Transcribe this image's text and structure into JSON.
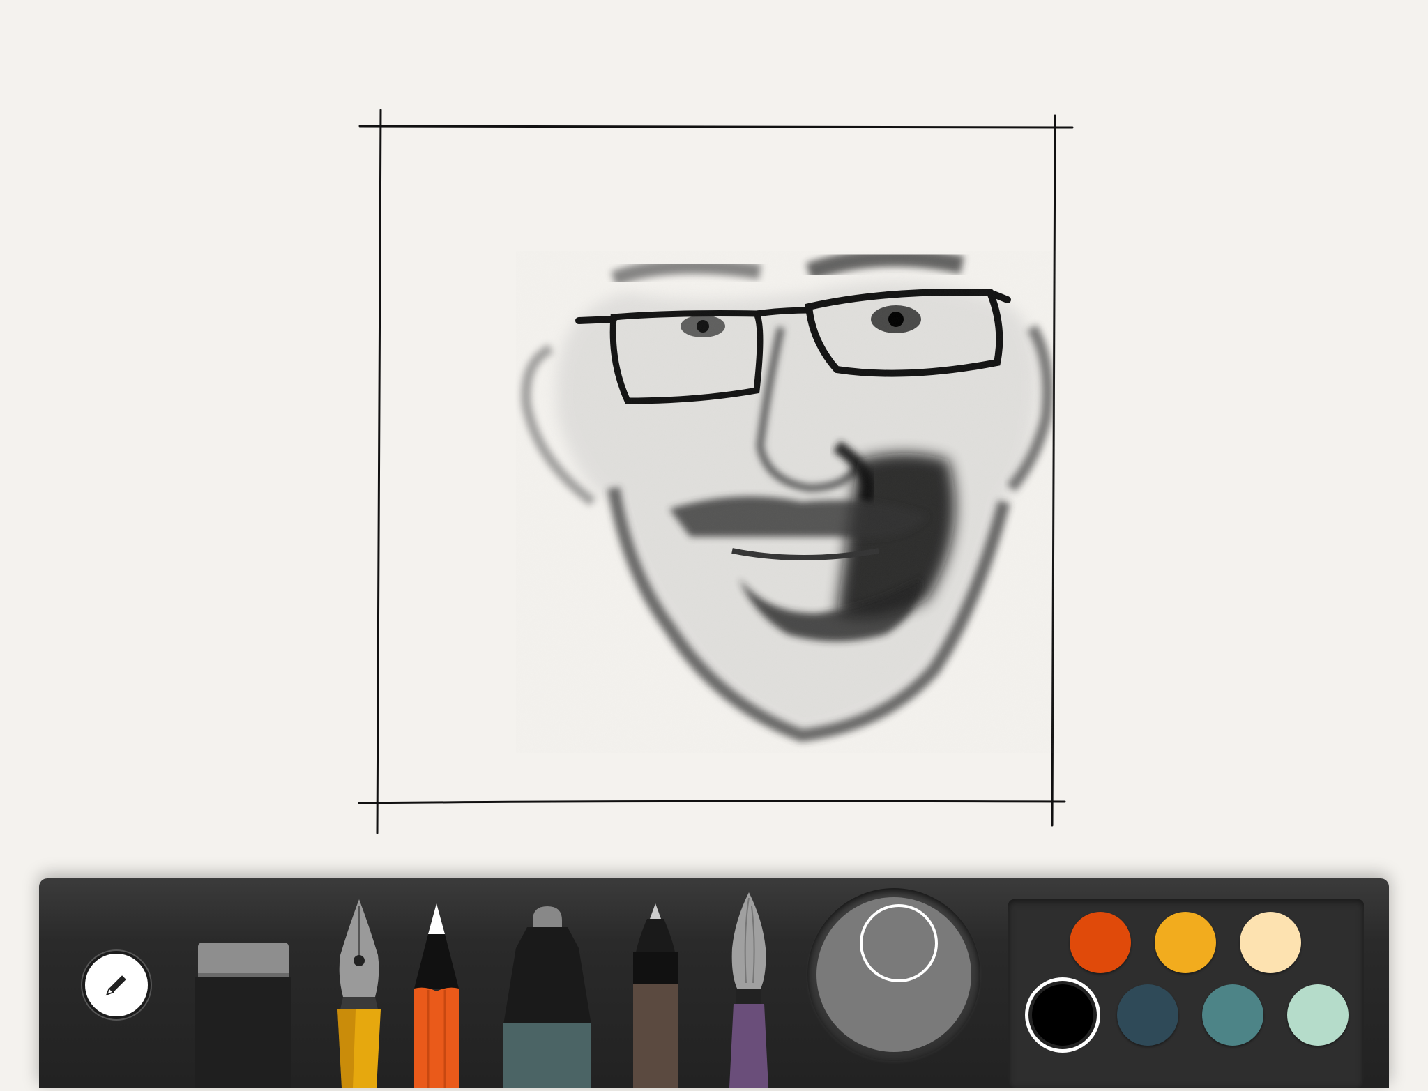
{
  "app": {
    "accent": "#e8e6e1"
  },
  "toolbar": {
    "menu_icon": "pencil-icon",
    "tools": [
      {
        "id": "eraser",
        "icon": "eraser-icon"
      },
      {
        "id": "fountain-pen",
        "icon": "fountain-pen-icon"
      },
      {
        "id": "pencil",
        "icon": "pencil-tool-icon"
      },
      {
        "id": "marker",
        "icon": "marker-icon"
      },
      {
        "id": "fineliner",
        "icon": "fineliner-icon"
      },
      {
        "id": "watercolor-brush",
        "icon": "brush-icon"
      }
    ],
    "current_color": "#7a7a7a"
  },
  "palette": {
    "colors": [
      "#e04a0a",
      "#f2ac1e",
      "#fde2b0",
      "#000000",
      "#2f4a58",
      "#4d8487",
      "#b5dcca"
    ],
    "selected_index": 3
  }
}
